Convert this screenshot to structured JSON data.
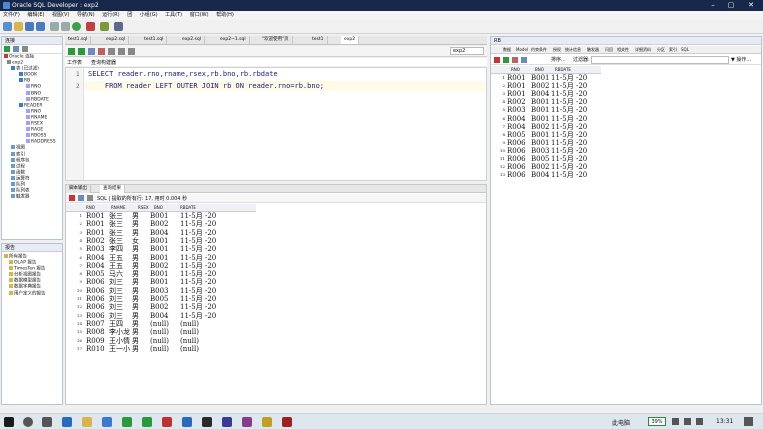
{
  "window": {
    "title": "Oracle SQL Developer : exp2"
  },
  "menu": [
    "文件(F)",
    "编辑(E)",
    "视图(V)",
    "导航(N)",
    "运行(R)",
    "团",
    "小组(G)",
    "工具(T)",
    "窗口(W)",
    "帮助(H)"
  ],
  "connections": {
    "header": "连接",
    "tree": [
      "Oracle 连接",
      "exp2",
      "表 (已过滤)",
      "BOOK",
      "RB",
      "RNO",
      "BNO",
      "RBDATE",
      "READER",
      "RNO",
      "RNAME",
      "RSEX",
      "RAGE",
      "RBOSS",
      "RADDRESS",
      "视图",
      "索引",
      "程序包",
      "过程",
      "函数",
      "运算符",
      "队列",
      "队列表",
      "触发器"
    ]
  },
  "reports": {
    "header": "报告",
    "items": [
      "所有报告",
      "OLAP 报告",
      "TimesTen 报告",
      "分析视图报告",
      "数据模型报告",
      "数据字典报告",
      "用户定义的报告"
    ]
  },
  "editor": {
    "tabs": [
      "test1.sql",
      "exp2.sql",
      "test1.sql",
      "exp2.sql",
      "exp2~1.sql",
      "\"欢迎使用\"页",
      "test1",
      "exp2"
    ],
    "connection": "exp2",
    "subtabs": [
      "工作表",
      "查询构建器"
    ],
    "lines": [
      {
        "n": "1",
        "text": "SELECT reader.rno,rname,rsex,rb.bno,rb.rbdate"
      },
      {
        "n": "2",
        "text": "    FROM reader LEFT OUTER JOIN rb ON reader.rno=rb.bno;"
      }
    ]
  },
  "results": {
    "tabs": [
      "脚本输出",
      "查询结果"
    ],
    "status": "SQL | 提取的所有行: 17, 用时 0.004 秒",
    "columns": [
      "RNO",
      "RNAME",
      "RSEX",
      "BNO",
      "RBDATE"
    ],
    "rows": [
      [
        "1",
        "R001",
        "张三",
        "男",
        "B001",
        "11-5月 -20"
      ],
      [
        "2",
        "R001",
        "张三",
        "男",
        "B002",
        "11-5月 -20"
      ],
      [
        "3",
        "R001",
        "张三",
        "男",
        "B004",
        "11-5月 -20"
      ],
      [
        "4",
        "R002",
        "张三",
        "女",
        "B001",
        "11-5月 -20"
      ],
      [
        "5",
        "R003",
        "李四",
        "男",
        "B001",
        "11-5月 -20"
      ],
      [
        "6",
        "R004",
        "王五",
        "男",
        "B001",
        "11-5月 -20"
      ],
      [
        "7",
        "R004",
        "王五",
        "男",
        "B002",
        "11-5月 -20"
      ],
      [
        "8",
        "R005",
        "马六",
        "男",
        "B001",
        "11-5月 -20"
      ],
      [
        "9",
        "R006",
        "刘三",
        "男",
        "B001",
        "11-5月 -20"
      ],
      [
        "10",
        "R006",
        "刘三",
        "男",
        "B003",
        "11-5月 -20"
      ],
      [
        "11",
        "R006",
        "刘三",
        "男",
        "B005",
        "11-5月 -20"
      ],
      [
        "12",
        "R006",
        "刘三",
        "男",
        "B002",
        "11-5月 -20"
      ],
      [
        "13",
        "R006",
        "刘三",
        "男",
        "B004",
        "11-5月 -20"
      ],
      [
        "14",
        "R007",
        "王四",
        "男",
        "(null)",
        "(null)"
      ],
      [
        "15",
        "R008",
        "李小龙",
        "男",
        "(null)",
        "(null)"
      ],
      [
        "16",
        "R009",
        "王小情",
        "男",
        "(null)",
        "(null)"
      ],
      [
        "17",
        "R010",
        "王一小",
        "男",
        "(null)",
        "(null)"
      ]
    ]
  },
  "rb": {
    "header": "RB",
    "tabs": [
      "数据",
      "Model",
      "约束条件",
      "授权",
      "统计信息",
      "触发器",
      "闪回",
      "相关性",
      "详细资料",
      "分区",
      "索引",
      "SQL"
    ],
    "sort_label": "排序...",
    "filter_label": "过滤器:",
    "actions_label": "▼ 操作...",
    "columns": [
      "RNO",
      "BNO",
      "RBDATE"
    ],
    "rows": [
      [
        "1",
        "R001",
        "B001",
        "11-5月 -20"
      ],
      [
        "2",
        "R001",
        "B002",
        "11-5月 -20"
      ],
      [
        "3",
        "R001",
        "B004",
        "11-5月 -20"
      ],
      [
        "4",
        "R002",
        "B001",
        "11-5月 -20"
      ],
      [
        "5",
        "R003",
        "B001",
        "11-5月 -20"
      ],
      [
        "6",
        "R004",
        "B001",
        "11-5月 -20"
      ],
      [
        "7",
        "R004",
        "B002",
        "11-5月 -20"
      ],
      [
        "8",
        "R005",
        "B001",
        "11-5月 -20"
      ],
      [
        "9",
        "R006",
        "B001",
        "11-5月 -20"
      ],
      [
        "10",
        "R006",
        "B003",
        "11-5月 -20"
      ],
      [
        "11",
        "R006",
        "B005",
        "11-5月 -20"
      ],
      [
        "12",
        "R006",
        "B002",
        "11-5月 -20"
      ],
      [
        "13",
        "R006",
        "B004",
        "11-5月 -20"
      ]
    ]
  },
  "taskbar": {
    "pc_label": "此电脑",
    "battery": "39%",
    "time": "13:31"
  }
}
